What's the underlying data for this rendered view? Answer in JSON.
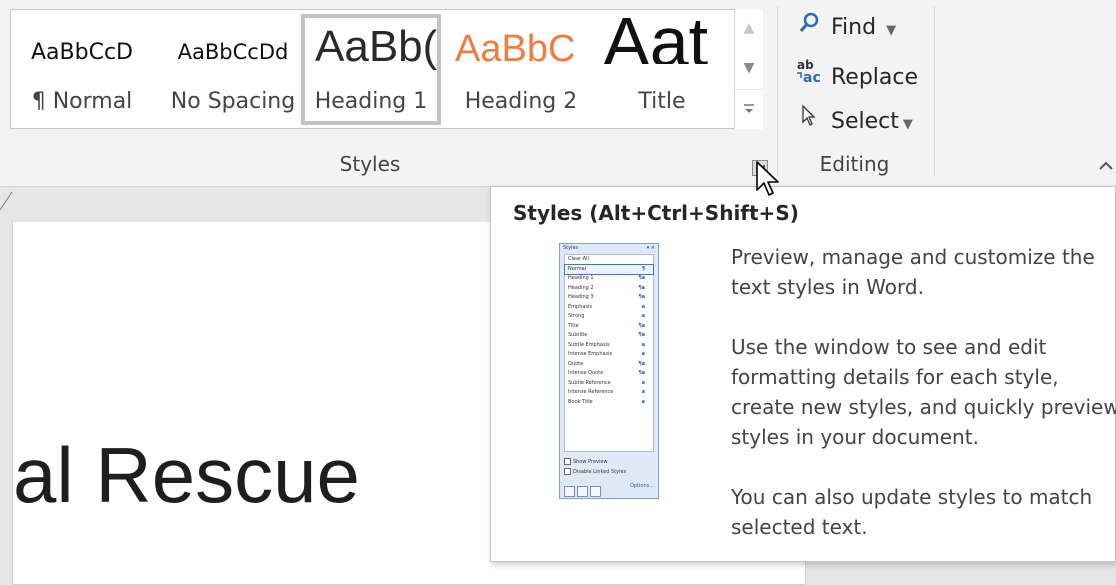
{
  "ribbon": {
    "style_gallery": [
      {
        "preview": "AaBbCcD",
        "name": "¶ Normal"
      },
      {
        "preview": "AaBbCcDd",
        "name": "No Spacing"
      },
      {
        "preview": "AaBb(",
        "name": "Heading 1"
      },
      {
        "preview": "AaBbC",
        "name": "Heading 2"
      },
      {
        "preview": "Aat",
        "name": "Title"
      }
    ],
    "styles_group_label": "Styles",
    "editing": {
      "find_label": "Find",
      "replace_label": "Replace",
      "select_label": "Select",
      "group_label": "Editing"
    }
  },
  "document": {
    "heading_text": "al Rescue"
  },
  "tooltip": {
    "title": "Styles (Alt+Ctrl+Shift+S)",
    "description_1": "Preview, manage and customize the text styles in Word.",
    "description_2": "Use the window to see and edit formatting details for each style, create new styles, and quickly preview styles in your document.",
    "description_3": "You can also update styles to match selected text.",
    "preview_pane": {
      "title": "Styles",
      "items": [
        {
          "label": "Clear All",
          "mark": ""
        },
        {
          "label": "Normal",
          "mark": "¶"
        },
        {
          "label": "Heading 1",
          "mark": "¶a"
        },
        {
          "label": "Heading 2",
          "mark": "¶a"
        },
        {
          "label": "Heading 3",
          "mark": "¶a"
        },
        {
          "label": "Emphasis",
          "mark": "a"
        },
        {
          "label": "Strong",
          "mark": "a"
        },
        {
          "label": "Title",
          "mark": "¶a"
        },
        {
          "label": "Subtitle",
          "mark": "¶a"
        },
        {
          "label": "Subtle Emphasis",
          "mark": "a"
        },
        {
          "label": "Intense Emphasis",
          "mark": "a"
        },
        {
          "label": "Quote",
          "mark": "¶a"
        },
        {
          "label": "Intense Quote",
          "mark": "¶a"
        },
        {
          "label": "Subtle Reference",
          "mark": "a"
        },
        {
          "label": "Intense Reference",
          "mark": "a"
        },
        {
          "label": "Book Title",
          "mark": "a"
        }
      ],
      "show_preview": "Show Preview",
      "disable_linked": "Disable Linked Styles",
      "options_label": "Options..."
    }
  }
}
